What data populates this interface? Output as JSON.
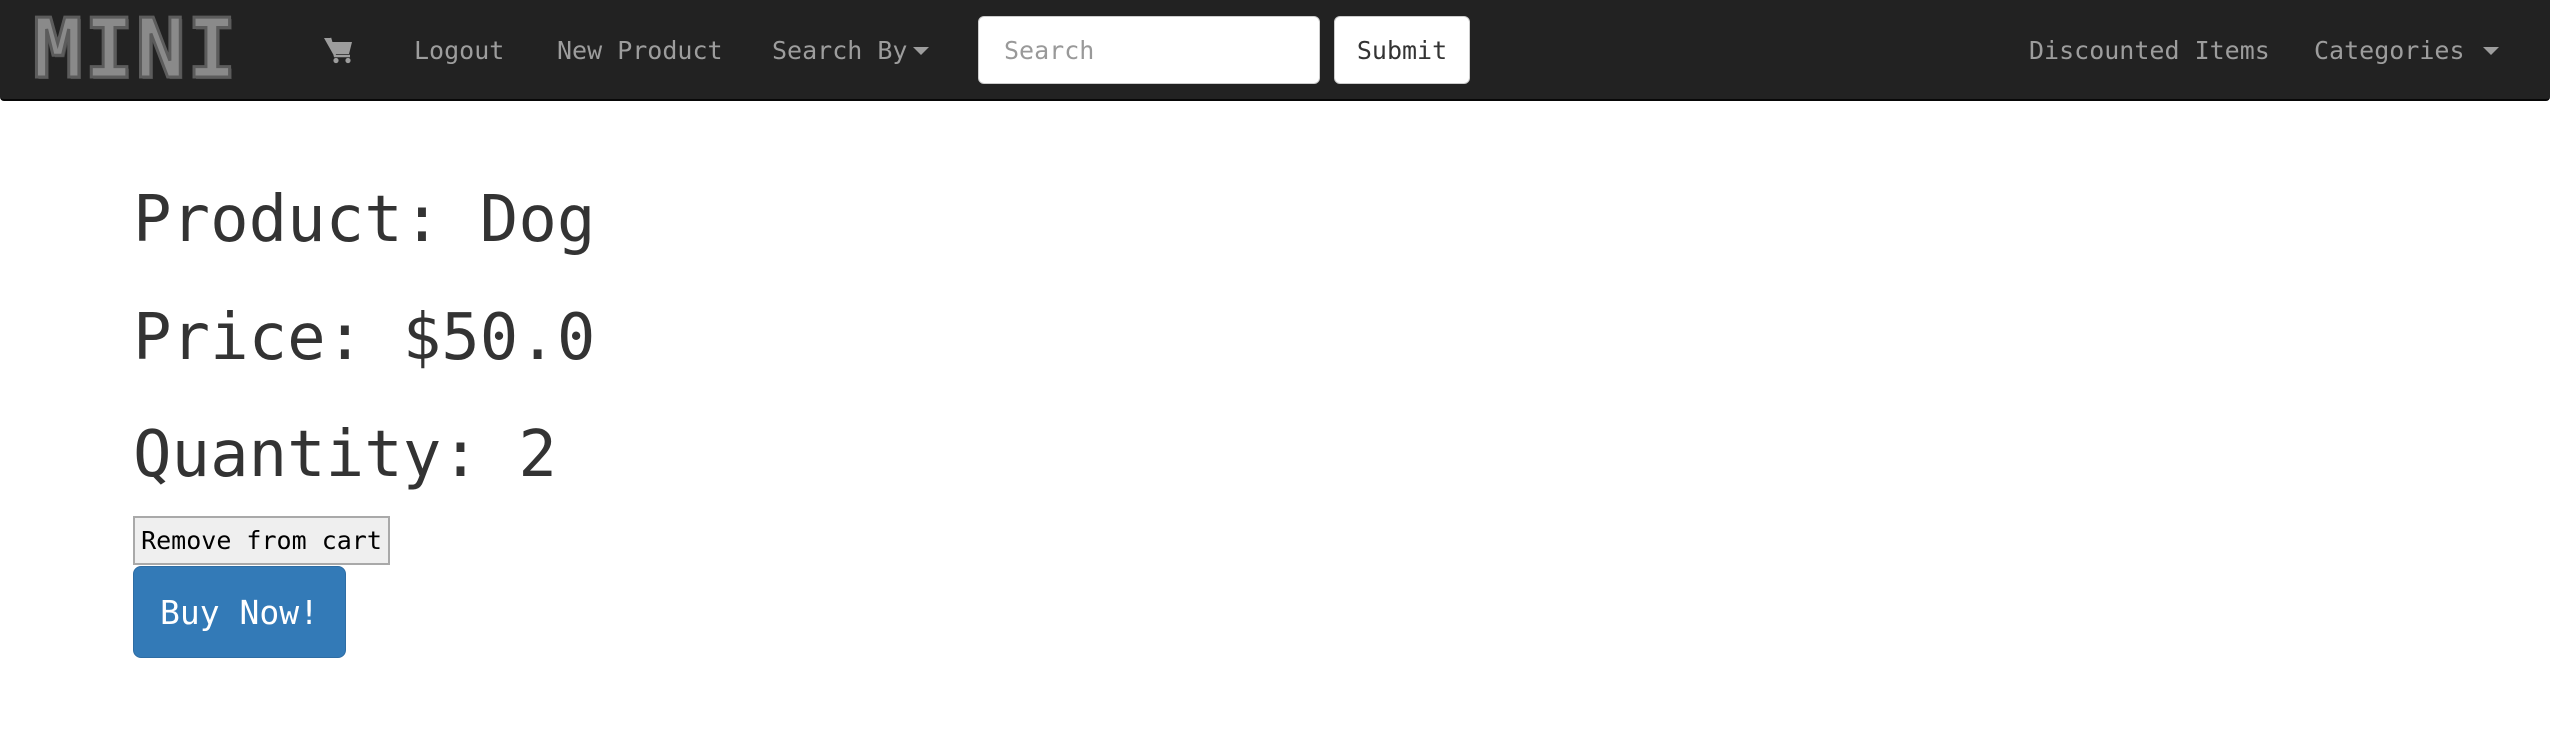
{
  "navbar": {
    "brand": "MINI",
    "cart_icon": "shopping-cart-icon",
    "links": {
      "logout": "Logout",
      "new_product": "New Product",
      "search_by": "Search By",
      "discounted_items": "Discounted Items",
      "categories": "Categories"
    },
    "search": {
      "placeholder": "Search",
      "value": ""
    },
    "submit_label": "Submit",
    "background_color": "#222222",
    "link_color": "#9d9d9d"
  },
  "product": {
    "name_line": "Product: Dog",
    "price_line": "Price: $50.0",
    "quantity_line": "Quantity: 2"
  },
  "actions": {
    "remove_label": "Remove from cart",
    "buy_label": "Buy Now!",
    "buy_color": "#337ab7"
  }
}
